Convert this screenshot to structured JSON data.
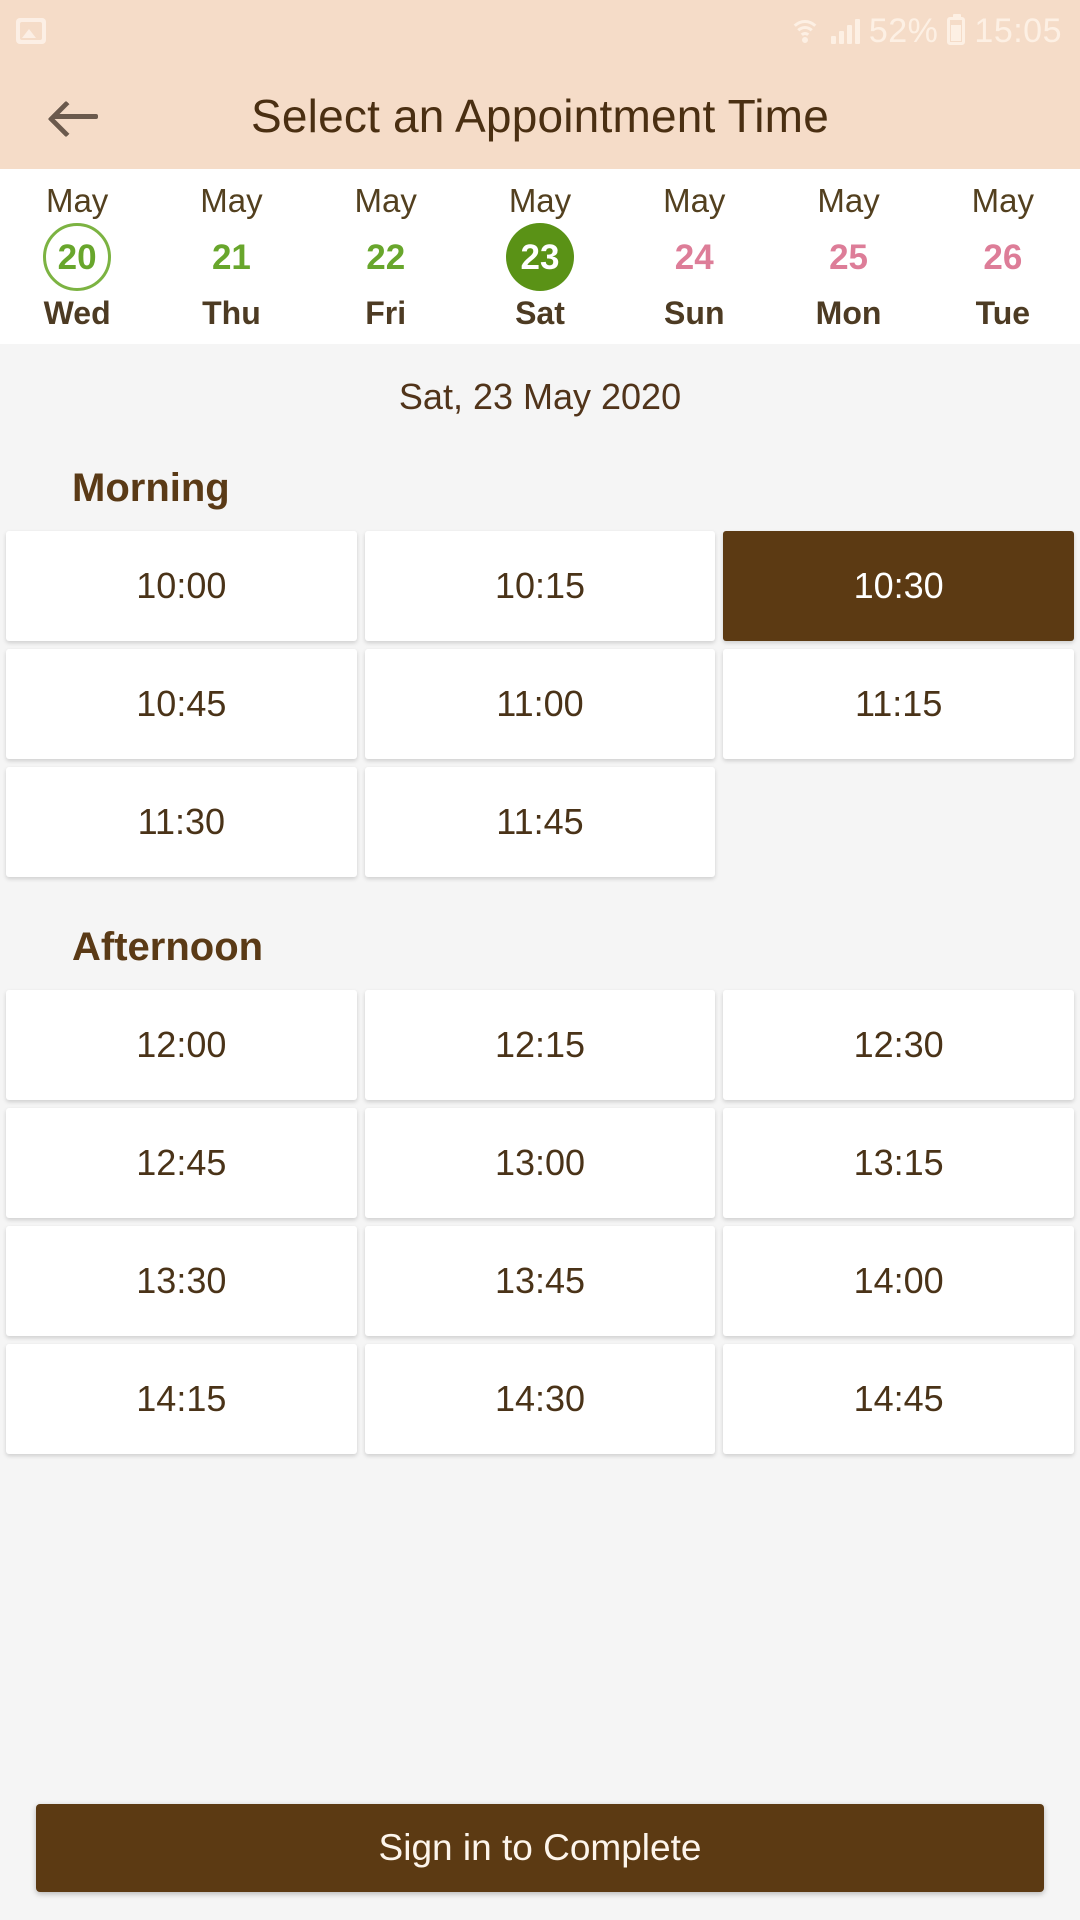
{
  "status_bar": {
    "left_icon": "image-icon",
    "wifi_icon": "wifi-icon",
    "signal_icon": "cellular-signal-icon",
    "battery_percent": "52%",
    "battery_icon": "battery-icon",
    "clock": "15:05"
  },
  "app_bar": {
    "back_icon": "back-arrow-icon",
    "title": "Select an Appointment Time"
  },
  "date_strip": {
    "days": [
      {
        "month": "May",
        "num": "20",
        "weekday": "Wed",
        "state": "today"
      },
      {
        "month": "May",
        "num": "21",
        "weekday": "Thu",
        "state": "available"
      },
      {
        "month": "May",
        "num": "22",
        "weekday": "Fri",
        "state": "available"
      },
      {
        "month": "May",
        "num": "23",
        "weekday": "Sat",
        "state": "selected"
      },
      {
        "month": "May",
        "num": "24",
        "weekday": "Sun",
        "state": "unavailable"
      },
      {
        "month": "May",
        "num": "25",
        "weekday": "Mon",
        "state": "unavailable"
      },
      {
        "month": "May",
        "num": "26",
        "weekday": "Tue",
        "state": "unavailable"
      }
    ]
  },
  "main": {
    "selected_date_label": "Sat, 23 May 2020",
    "sections": [
      {
        "title": "Morning",
        "slots": [
          "10:00",
          "10:15",
          "10:30",
          "10:45",
          "11:00",
          "11:15",
          "11:30",
          "11:45"
        ],
        "selected_slot": "10:30"
      },
      {
        "title": "Afternoon",
        "slots": [
          "12:00",
          "12:15",
          "12:30",
          "12:45",
          "13:00",
          "13:15",
          "13:30",
          "13:45",
          "14:00",
          "14:15",
          "14:30",
          "14:45"
        ],
        "selected_slot": null
      }
    ]
  },
  "bottom_bar": {
    "primary_action_label": "Sign in to Complete"
  },
  "colors": {
    "header_background": "#f5dcc8",
    "accent_brown": "#5c3a13",
    "title_brown": "#4a2f12",
    "available_green": "#68a62c",
    "selected_day_green": "#5a9216",
    "unavailable_pink": "#dd7d98",
    "content_background": "#f5f5f5",
    "card_background": "#ffffff"
  }
}
